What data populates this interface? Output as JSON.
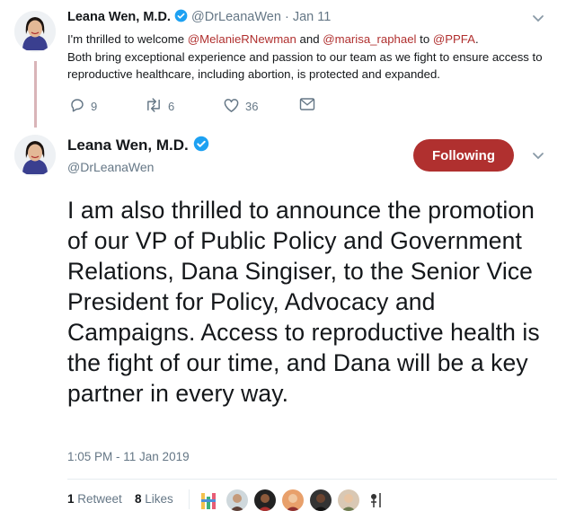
{
  "reply_tweet": {
    "author_name": "Leana Wen, M.D.",
    "handle": "@DrLeanaWen",
    "separator": "·",
    "date": "Jan 11",
    "text_parts": [
      "I'm thrilled to welcome ",
      "@MelanieRNewman",
      " and ",
      "@marisa_raphael",
      " to ",
      "@PPFA",
      ".",
      "Both bring exceptional experience and passion to our team as we fight to ensure access to reproductive healthcare, including abortion, is protected and expanded."
    ],
    "reply_count": "9",
    "retweet_count": "6",
    "like_count": "36"
  },
  "main_tweet": {
    "author_name": "Leana Wen, M.D.",
    "handle": "@DrLeanaWen",
    "follow_label": "Following",
    "text": "I am also thrilled to announce the promotion of our VP of Public Policy and Government Relations, Dana Singiser, to the Senior Vice President for Policy, Advocacy and Campaigns. Access to reproductive health is the fight of our time, and Dana will be a key partner in every way.",
    "timestamp": "1:05 PM - 11 Jan 2019",
    "retweet_count": "1",
    "retweet_label": "Retweet",
    "like_count": "8",
    "like_label": "Likes"
  },
  "colors": {
    "accent": "#b0302f",
    "verified": "#1da1f2",
    "muted": "#657786"
  }
}
